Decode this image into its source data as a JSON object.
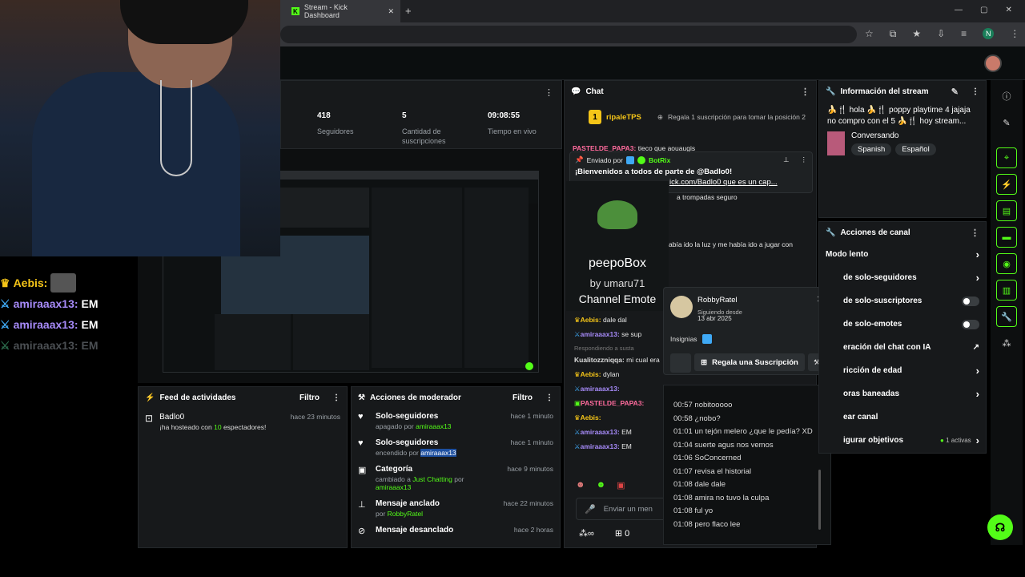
{
  "browser": {
    "tab_title": "Stream - Kick Dashboard",
    "new_tab": "+",
    "profile_initial": "N",
    "window_controls": [
      "—",
      "▢",
      "✕"
    ]
  },
  "stats": {
    "followers_value": "418",
    "followers_label": "Seguidores",
    "subs_value": "5",
    "subs_label": "Cantidad de suscripciones",
    "live_value": "09:08:55",
    "live_label": "Tiempo en vivo"
  },
  "overlay_chat": [
    {
      "user": "Aebis:",
      "text": "",
      "color": "#f5c518"
    },
    {
      "user": "amiraaax13:",
      "text": "EM",
      "color": "#a78bfa"
    },
    {
      "user": "amiraaax13:",
      "text": "EM",
      "color": "#a78bfa"
    },
    {
      "user": "amiraaax13:",
      "text": "EM",
      "color": "#6b6f73"
    }
  ],
  "feed": {
    "title": "Feed de actividades",
    "filter": "Filtro",
    "items": [
      {
        "name": "Badlo0",
        "desc": "¡ha hosteado con ",
        "count": "10",
        "desc2": " espectadores!",
        "time": "hace 23 minutos"
      }
    ]
  },
  "mod": {
    "title": "Acciones de moderador",
    "filter": "Filtro",
    "items": [
      {
        "title": "Solo-seguidores",
        "pre": "apagado por ",
        "user": "amiraaax13",
        "time": "hace 1 minuto",
        "icon": "heart-icon",
        "glyph": "♥"
      },
      {
        "title": "Solo-seguidores",
        "pre": "encendido por ",
        "user": "amiraaax13",
        "time": "hace 1 minuto",
        "icon": "heart-icon",
        "glyph": "♥"
      },
      {
        "title": "Categoría",
        "pre": "cambiado a ",
        "user": "Just Chatting",
        "post": " por ",
        "user2": "amiraaax13",
        "time": "hace 9 minutos",
        "icon": "category-icon",
        "glyph": "▣"
      },
      {
        "title": "Mensaje anclado",
        "pre": "por ",
        "user": "RobbyRatel",
        "time": "hace 22 minutos",
        "icon": "pin-icon",
        "glyph": "📌"
      },
      {
        "title": "Mensaje desanclado",
        "pre": "",
        "user": "",
        "time": "hace 2 horas",
        "icon": "unpin-icon",
        "glyph": "✕"
      }
    ]
  },
  "chat": {
    "title": "Chat",
    "top_user": "ripaleTPS",
    "top_rank": "1",
    "gift_prompt": "Regala 1 suscripción para tomar la posición 2",
    "pinned_by": "Enviado por",
    "pinned_user": "BotRix",
    "pinned_text": "¡Bienvenidos a todos de parte de @Badlo0!",
    "pinned_text2": "ick.com/Badlo0 que es un cap...",
    "lines": [
      {
        "user": "PASTELDE_PAPA3:",
        "text": " tieco que aouaugis",
        "color": "#ff6b9d"
      },
      {
        "user": "",
        "text": "a trompadas seguro",
        "color": ""
      },
      {
        "user": "",
        "text": "abía ido la luz y me había ido a jugar con",
        "color": ""
      }
    ],
    "emote_name": "peepoBox",
    "emote_by": "by umaru71",
    "emote_type": "Channel Emote",
    "lower_lines": [
      {
        "user": "Aebis:",
        "text": " dale dal",
        "color": "#f5c518"
      },
      {
        "user": "amiraaax13:",
        "text": " se sup",
        "color": "#a78bfa"
      },
      {
        "user": "",
        "text": "Respondiendo a susta",
        "color": "#777"
      },
      {
        "user": "Kualitozzniqqa:",
        "text": " mi cual era",
        "color": "#ddd"
      },
      {
        "user": "Aebis:",
        "text": " dylan",
        "color": "#f5c518"
      },
      {
        "user": "amiraaax13:",
        "text": "",
        "color": "#a78bfa"
      },
      {
        "user": "PASTELDE_PAPA3:",
        "text": "",
        "color": "#ff6b9d"
      },
      {
        "user": "Aebis:",
        "text": "",
        "color": "#f5c518"
      },
      {
        "user": "amiraaax13:",
        "text": " EM",
        "color": "#a78bfa"
      },
      {
        "user": "amiraaax13:",
        "text": " EM",
        "color": "#a78bfa"
      }
    ],
    "input_placeholder": "Enviar un men",
    "footer_count": "0"
  },
  "user_card": {
    "name": "RobbyRatel",
    "following_label": "Siguiendo desde",
    "following_date": "13 abr 2025",
    "badges_label": "Insignias",
    "gift_button": "Regala una Suscripción"
  },
  "history": [
    "00:57 nobitooooo",
    "00:58 ¿nobo?",
    "01:01 un tejón melero ¿que le pedía? XD",
    "01:04 suerte agus nos vemos",
    "01:06 SoConcerned",
    "01:07 revisa el historial",
    "01:08 dale dale",
    "01:08 amira no tuvo la culpa",
    "01:08 ful yo",
    "01:08 pero flaco lee"
  ],
  "stream_info": {
    "title": "Información del stream",
    "text": "🍌🍴 hola 🍌🍴 poppy playtime 4 jajaja no compro con el 5 🍌🍴 hoy stream...",
    "category": "Conversando",
    "tags": [
      "Spanish",
      "Español"
    ]
  },
  "channel_actions": {
    "title": "Acciones de canal",
    "rows": [
      {
        "label": "Modo lento",
        "control": "chevron"
      },
      {
        "label": "de solo-seguidores",
        "control": "chevron"
      },
      {
        "label": "de solo-suscriptores",
        "control": "toggle"
      },
      {
        "label": "de solo-emotes",
        "control": "toggle"
      },
      {
        "label": "eración del chat con IA",
        "control": "external"
      },
      {
        "label": "ricción de edad",
        "control": "chevron"
      },
      {
        "label": "oras baneadas",
        "control": "chevron"
      },
      {
        "label": "ear canal",
        "control": "none"
      },
      {
        "label": "igurar objetivos",
        "control": "active",
        "extra": "1 activas"
      }
    ]
  },
  "colors": {
    "brand": "#53fc18",
    "panel": "#17191b",
    "bg": "#0b0e0f"
  }
}
